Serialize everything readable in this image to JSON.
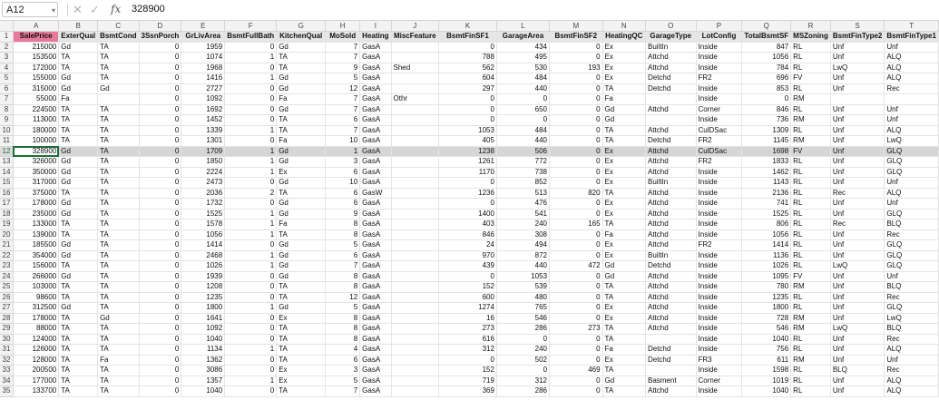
{
  "formula_bar": {
    "cell_ref": "A12",
    "fx_label": "fx",
    "cancel_glyph": "✕",
    "confirm_glyph": "✓",
    "value": "328900"
  },
  "sheet": {
    "columns": [
      "A",
      "B",
      "C",
      "D",
      "E",
      "F",
      "G",
      "H",
      "I",
      "J",
      "K",
      "L",
      "M",
      "N",
      "O",
      "P",
      "Q",
      "R",
      "S",
      "T"
    ],
    "header": [
      "SalePrice",
      "ExterQual",
      "BsmtCond",
      "3SsnPorch",
      "GrLivArea",
      "BsmtFullBath",
      "KitchenQual",
      "MoSold",
      "Heating",
      "MiscFeature",
      "BsmtFinSF1",
      "GarageArea",
      "BsmtFinSF2",
      "HeatingQC",
      "GarageType",
      "LotConfig",
      "TotalBsmtSF",
      "MSZoning",
      "BsmtFinType2",
      "BsmtFinType1"
    ],
    "selected_row": 12,
    "rows": [
      [
        "215000",
        "Gd",
        "TA",
        "0",
        "1959",
        "0",
        "Gd",
        "7",
        "GasA",
        "",
        "0",
        "434",
        "0",
        "Ex",
        "BuiltIn",
        "Inside",
        "847",
        "RL",
        "Unf",
        "Unf"
      ],
      [
        "153500",
        "TA",
        "TA",
        "0",
        "1074",
        "1",
        "TA",
        "7",
        "GasA",
        "",
        "788",
        "495",
        "0",
        "Ex",
        "Attchd",
        "Inside",
        "1056",
        "RL",
        "Unf",
        "ALQ"
      ],
      [
        "172000",
        "TA",
        "TA",
        "0",
        "1968",
        "0",
        "TA",
        "9",
        "GasA",
        "Shed",
        "562",
        "530",
        "193",
        "Ex",
        "Attchd",
        "Inside",
        "784",
        "RL",
        "LwQ",
        "ALQ"
      ],
      [
        "155000",
        "Gd",
        "TA",
        "0",
        "1416",
        "1",
        "Gd",
        "5",
        "GasA",
        "",
        "604",
        "484",
        "0",
        "Ex",
        "Detchd",
        "FR2",
        "696",
        "FV",
        "Unf",
        "ALQ"
      ],
      [
        "315000",
        "Gd",
        "Gd",
        "0",
        "2727",
        "0",
        "Gd",
        "12",
        "GasA",
        "",
        "297",
        "440",
        "0",
        "TA",
        "Detchd",
        "Inside",
        "853",
        "RL",
        "Unf",
        "Rec"
      ],
      [
        "55000",
        "Fa",
        "",
        "0",
        "1092",
        "0",
        "Fa",
        "7",
        "GasA",
        "Othr",
        "0",
        "0",
        "0",
        "Fa",
        "",
        "Inside",
        "0",
        "RM",
        "",
        ""
      ],
      [
        "224500",
        "TA",
        "TA",
        "0",
        "1692",
        "0",
        "Gd",
        "7",
        "GasA",
        "",
        "0",
        "650",
        "0",
        "Gd",
        "Attchd",
        "Corner",
        "846",
        "RL",
        "Unf",
        "Unf"
      ],
      [
        "113000",
        "TA",
        "TA",
        "0",
        "1452",
        "0",
        "TA",
        "6",
        "GasA",
        "",
        "0",
        "0",
        "0",
        "Gd",
        "",
        "Inside",
        "736",
        "RM",
        "Unf",
        "Unf"
      ],
      [
        "180000",
        "TA",
        "TA",
        "0",
        "1339",
        "1",
        "TA",
        "7",
        "GasA",
        "",
        "1053",
        "484",
        "0",
        "TA",
        "Attchd",
        "CulDSac",
        "1309",
        "RL",
        "Unf",
        "ALQ"
      ],
      [
        "100000",
        "TA",
        "TA",
        "0",
        "1301",
        "0",
        "Fa",
        "10",
        "GasA",
        "",
        "405",
        "440",
        "0",
        "TA",
        "Detchd",
        "FR2",
        "1145",
        "RM",
        "Unf",
        "LwQ"
      ],
      [
        "328900",
        "Gd",
        "TA",
        "0",
        "1709",
        "1",
        "Gd",
        "1",
        "GasA",
        "",
        "1238",
        "506",
        "0",
        "Ex",
        "Attchd",
        "CulDSac",
        "1698",
        "FV",
        "Unf",
        "GLQ"
      ],
      [
        "326000",
        "Gd",
        "TA",
        "0",
        "1850",
        "1",
        "Gd",
        "3",
        "GasA",
        "",
        "1261",
        "772",
        "0",
        "Ex",
        "Attchd",
        "FR2",
        "1833",
        "RL",
        "Unf",
        "GLQ"
      ],
      [
        "350000",
        "Gd",
        "TA",
        "0",
        "2224",
        "1",
        "Ex",
        "6",
        "GasA",
        "",
        "1170",
        "738",
        "0",
        "Ex",
        "Attchd",
        "Inside",
        "1462",
        "RL",
        "Unf",
        "GLQ"
      ],
      [
        "317000",
        "Gd",
        "TA",
        "0",
        "2473",
        "0",
        "Gd",
        "10",
        "GasA",
        "",
        "0",
        "852",
        "0",
        "Ex",
        "BuiltIn",
        "Inside",
        "1143",
        "RL",
        "Unf",
        "Unf"
      ],
      [
        "375000",
        "TA",
        "TA",
        "0",
        "2036",
        "2",
        "TA",
        "6",
        "GasW",
        "",
        "1236",
        "513",
        "820",
        "TA",
        "Attchd",
        "Inside",
        "2136",
        "RL",
        "Rec",
        "ALQ"
      ],
      [
        "178000",
        "Gd",
        "TA",
        "0",
        "1732",
        "0",
        "Gd",
        "6",
        "GasA",
        "",
        "0",
        "476",
        "0",
        "Ex",
        "Attchd",
        "Inside",
        "741",
        "RL",
        "Unf",
        "Unf"
      ],
      [
        "235000",
        "Gd",
        "TA",
        "0",
        "1525",
        "1",
        "Gd",
        "9",
        "GasA",
        "",
        "1400",
        "541",
        "0",
        "Ex",
        "Attchd",
        "Inside",
        "1525",
        "RL",
        "Unf",
        "GLQ"
      ],
      [
        "133000",
        "TA",
        "TA",
        "0",
        "1578",
        "1",
        "Fa",
        "8",
        "GasA",
        "",
        "403",
        "240",
        "165",
        "TA",
        "Attchd",
        "Inside",
        "806",
        "RL",
        "Rec",
        "BLQ"
      ],
      [
        "139000",
        "TA",
        "TA",
        "0",
        "1056",
        "1",
        "TA",
        "8",
        "GasA",
        "",
        "846",
        "308",
        "0",
        "Fa",
        "Attchd",
        "Inside",
        "1056",
        "RL",
        "Unf",
        "Rec"
      ],
      [
        "185500",
        "Gd",
        "TA",
        "0",
        "1414",
        "0",
        "Gd",
        "5",
        "GasA",
        "",
        "24",
        "494",
        "0",
        "Ex",
        "Attchd",
        "FR2",
        "1414",
        "RL",
        "Unf",
        "GLQ"
      ],
      [
        "354000",
        "Gd",
        "TA",
        "0",
        "2468",
        "1",
        "Gd",
        "6",
        "GasA",
        "",
        "970",
        "872",
        "0",
        "Ex",
        "BuiltIn",
        "Inside",
        "1136",
        "RL",
        "Unf",
        "GLQ"
      ],
      [
        "156000",
        "TA",
        "TA",
        "0",
        "1026",
        "1",
        "Gd",
        "7",
        "GasA",
        "",
        "439",
        "440",
        "472",
        "Gd",
        "Detchd",
        "Inside",
        "1026",
        "RL",
        "LwQ",
        "GLQ"
      ],
      [
        "266000",
        "Gd",
        "TA",
        "0",
        "1939",
        "0",
        "Gd",
        "8",
        "GasA",
        "",
        "0",
        "1053",
        "0",
        "Gd",
        "Attchd",
        "Inside",
        "1095",
        "FV",
        "Unf",
        "Unf"
      ],
      [
        "103000",
        "TA",
        "TA",
        "0",
        "1208",
        "0",
        "TA",
        "8",
        "GasA",
        "",
        "152",
        "539",
        "0",
        "TA",
        "Attchd",
        "Inside",
        "780",
        "RM",
        "Unf",
        "BLQ"
      ],
      [
        "98600",
        "TA",
        "TA",
        "0",
        "1235",
        "0",
        "TA",
        "12",
        "GasA",
        "",
        "600",
        "480",
        "0",
        "TA",
        "Attchd",
        "Inside",
        "1235",
        "RL",
        "Unf",
        "Rec"
      ],
      [
        "312500",
        "Gd",
        "TA",
        "0",
        "1800",
        "1",
        "Gd",
        "5",
        "GasA",
        "",
        "1274",
        "765",
        "0",
        "Ex",
        "Attchd",
        "Inside",
        "1800",
        "RL",
        "Unf",
        "GLQ"
      ],
      [
        "178000",
        "TA",
        "Gd",
        "0",
        "1641",
        "0",
        "Ex",
        "8",
        "GasA",
        "",
        "16",
        "546",
        "0",
        "Ex",
        "Attchd",
        "Inside",
        "728",
        "RM",
        "Unf",
        "LwQ"
      ],
      [
        "88000",
        "TA",
        "TA",
        "0",
        "1092",
        "0",
        "TA",
        "8",
        "GasA",
        "",
        "273",
        "286",
        "273",
        "TA",
        "Attchd",
        "Inside",
        "546",
        "RM",
        "LwQ",
        "BLQ"
      ],
      [
        "124000",
        "TA",
        "TA",
        "0",
        "1040",
        "0",
        "TA",
        "8",
        "GasA",
        "",
        "616",
        "0",
        "0",
        "TA",
        "",
        "Inside",
        "1040",
        "RL",
        "Unf",
        "Rec"
      ],
      [
        "126000",
        "TA",
        "TA",
        "0",
        "1134",
        "1",
        "TA",
        "4",
        "GasA",
        "",
        "312",
        "240",
        "0",
        "Fa",
        "Detchd",
        "Inside",
        "756",
        "RL",
        "Unf",
        "ALQ"
      ],
      [
        "128000",
        "TA",
        "Fa",
        "0",
        "1362",
        "0",
        "TA",
        "6",
        "GasA",
        "",
        "0",
        "502",
        "0",
        "Ex",
        "Detchd",
        "FR3",
        "611",
        "RM",
        "Unf",
        "Unf"
      ],
      [
        "200500",
        "TA",
        "TA",
        "0",
        "3086",
        "0",
        "Ex",
        "3",
        "GasA",
        "",
        "152",
        "0",
        "469",
        "TA",
        "",
        "Inside",
        "1598",
        "RL",
        "BLQ",
        "Rec"
      ],
      [
        "177000",
        "TA",
        "TA",
        "0",
        "1357",
        "1",
        "Ex",
        "5",
        "GasA",
        "",
        "719",
        "312",
        "0",
        "Gd",
        "Basment",
        "Corner",
        "1019",
        "RL",
        "Unf",
        "ALQ"
      ],
      [
        "133700",
        "TA",
        "TA",
        "0",
        "1040",
        "0",
        "TA",
        "7",
        "GasA",
        "",
        "369",
        "286",
        "0",
        "TA",
        "Attchd",
        "Inside",
        "1040",
        "RL",
        "Unf",
        "ALQ"
      ]
    ]
  }
}
